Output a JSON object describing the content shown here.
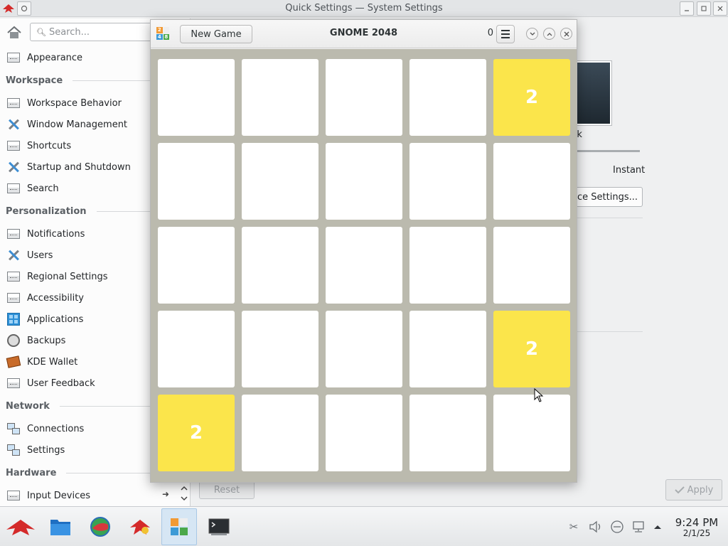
{
  "settings_window": {
    "title": "Quick Settings — System Settings",
    "search_placeholder": "Search...",
    "sidebar": {
      "top_items": [
        {
          "label": "Appearance",
          "icon": "settings-box-icon"
        }
      ],
      "sections": [
        {
          "heading": "Workspace",
          "items": [
            {
              "label": "Workspace Behavior",
              "icon": "settings-box-icon"
            },
            {
              "label": "Window Management",
              "icon": "tools-icon"
            },
            {
              "label": "Shortcuts",
              "icon": "settings-box-icon"
            },
            {
              "label": "Startup and Shutdown",
              "icon": "tools-icon"
            },
            {
              "label": "Search",
              "icon": "settings-box-icon"
            }
          ]
        },
        {
          "heading": "Personalization",
          "items": [
            {
              "label": "Notifications",
              "icon": "settings-box-icon"
            },
            {
              "label": "Users",
              "icon": "tools-icon"
            },
            {
              "label": "Regional Settings",
              "icon": "settings-box-icon"
            },
            {
              "label": "Accessibility",
              "icon": "settings-box-icon"
            },
            {
              "label": "Applications",
              "icon": "applications-icon"
            },
            {
              "label": "Backups",
              "icon": "backup-clock-icon"
            },
            {
              "label": "KDE Wallet",
              "icon": "wallet-icon"
            },
            {
              "label": "User Feedback",
              "icon": "settings-box-icon"
            }
          ]
        },
        {
          "heading": "Network",
          "items": [
            {
              "label": "Connections",
              "icon": "network-icon"
            },
            {
              "label": "Settings",
              "icon": "network-icon"
            }
          ]
        },
        {
          "heading": "Hardware",
          "items": [
            {
              "label": "Input Devices",
              "icon": "settings-box-icon"
            }
          ]
        }
      ]
    },
    "right_pane": {
      "preview_label": "rk",
      "slider_end_label": "Instant",
      "advanced_button": "nce Settings...",
      "reset_button": "Reset",
      "apply_button": "Apply"
    }
  },
  "game_window": {
    "title": "GNOME 2048",
    "new_game_label": "New Game",
    "score": "0",
    "tile_colors": {
      "empty": "#ffffff",
      "2": "#fbe54b",
      "board_bg": "#bbbaae"
    },
    "grid": [
      [
        "",
        "",
        "",
        "",
        "2"
      ],
      [
        "",
        "",
        "",
        "",
        ""
      ],
      [
        "",
        "",
        "",
        "",
        ""
      ],
      [
        "",
        "",
        "",
        "",
        "2"
      ],
      [
        "2",
        "",
        "",
        "",
        ""
      ]
    ]
  },
  "taskbar": {
    "clock_time": "9:24 PM",
    "clock_date": "2/1/25",
    "apps": [
      "app-launcher-icon",
      "file-manager-icon",
      "web-browser-icon",
      "kde-settings-icon",
      "gnome-2048-icon",
      "terminal-icon"
    ],
    "active_app": "gnome-2048-icon"
  }
}
